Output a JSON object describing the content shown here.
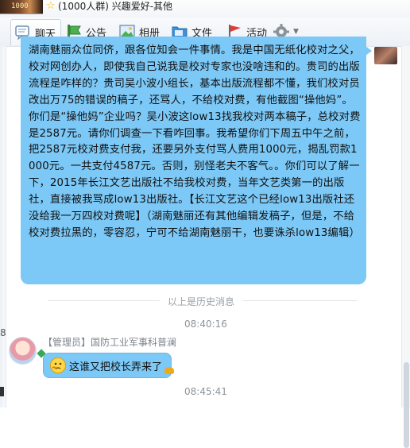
{
  "header": {
    "group_name": "(1000人群) 兴趣爱好-其他",
    "avatar_text": "1000",
    "star_icon": "star-icon"
  },
  "toolbar": {
    "tabs": [
      {
        "label": "聊天",
        "icon": "chat-icon",
        "active": true
      },
      {
        "label": "公告",
        "icon": "announcement-icon",
        "active": false
      },
      {
        "label": "相册",
        "icon": "album-icon",
        "active": false
      },
      {
        "label": "文件",
        "icon": "folder-icon",
        "active": false
      },
      {
        "label": "活动",
        "icon": "flag-icon",
        "active": false
      }
    ],
    "settings_icon": "gear-icon"
  },
  "messages": {
    "long_text": "湖南魅丽众位同侪，跟各位知会一件事情。我是中国无纸化校对之父，校对网创办人，即使我自己说我是校对专家也没啥违和的。贵司的出版流程是咋样的？贵司吴小波小组长，基本出版流程都不懂，我们校对员改出万75的错误的稿子，还骂人，不给校对费，有他截图“操他妈”。你们是“操他妈”企业吗？吴小波这low13找我校对两本稿子，总校对费是2587元。请你们调查一下看咋回事。我希望你们下周五中午之前，把2587元校对费支付我，还要另外支付骂人费用1000元，揭乱罚款1000元。一共支付4587元。否则，别怪老夫不客气。。你们可以了解一下，2015年长江文艺出版社不给我校对费，当年文艺类第一的出版社，直接被我骂成low13出版社。【长江文艺这个已经low13出版社还没给我一万四校对费呢】（湖南魅丽还有其他编辑发稿子，但是，不给校对费拉黑的，零容忍，宁可不给湖南魅丽干，也要诛杀low13编辑）",
    "history_label": "以上是历史消息",
    "time1": "08:40:16",
    "sender_name": "【管理员】国防工业军事科普澜",
    "short_text": "这谁又把校长弄来了",
    "time2": "08:45:41",
    "edge_char": "8"
  }
}
